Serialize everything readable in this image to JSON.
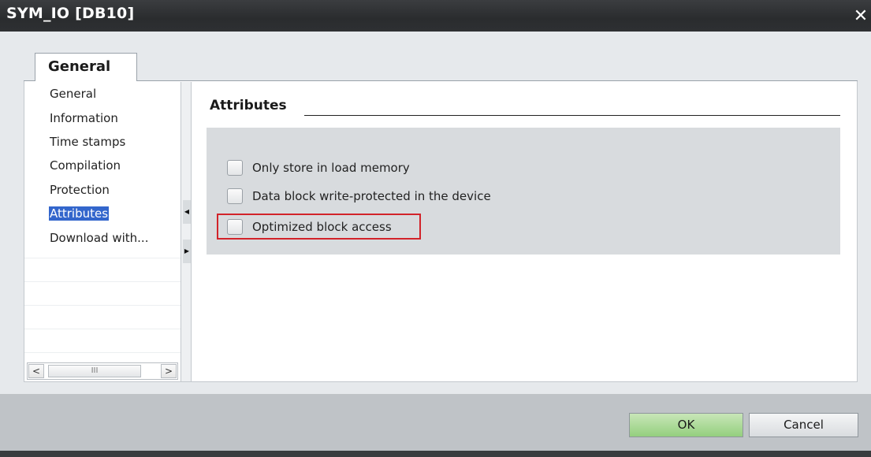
{
  "window": {
    "title": "SYM_IO [DB10]",
    "close_glyph": "✕"
  },
  "tabs": [
    {
      "label": "General",
      "selected": true
    }
  ],
  "nav": {
    "items": [
      {
        "label": "General",
        "selected": false
      },
      {
        "label": "Information",
        "selected": false
      },
      {
        "label": "Time stamps",
        "selected": false
      },
      {
        "label": "Compilation",
        "selected": false
      },
      {
        "label": "Protection",
        "selected": false
      },
      {
        "label": "Attributes",
        "selected": true
      },
      {
        "label": "Download with...",
        "selected": false
      }
    ],
    "scrollbar": {
      "left_glyph": "<",
      "thumb_glyph": "III",
      "right_glyph": ">"
    }
  },
  "attributes": {
    "section_title": "Attributes",
    "checkboxes": [
      {
        "label": "Only store in load memory",
        "checked": false
      },
      {
        "label": "Data block write-protected in the device",
        "checked": false
      },
      {
        "label": "Optimized block access",
        "checked": false,
        "highlighted": true
      }
    ],
    "highlight_color": "#d2232a"
  },
  "footer": {
    "ok_label": "OK",
    "cancel_label": "Cancel"
  },
  "colors": {
    "ok_button": "#94cf7e",
    "selection": "#3366cc"
  }
}
